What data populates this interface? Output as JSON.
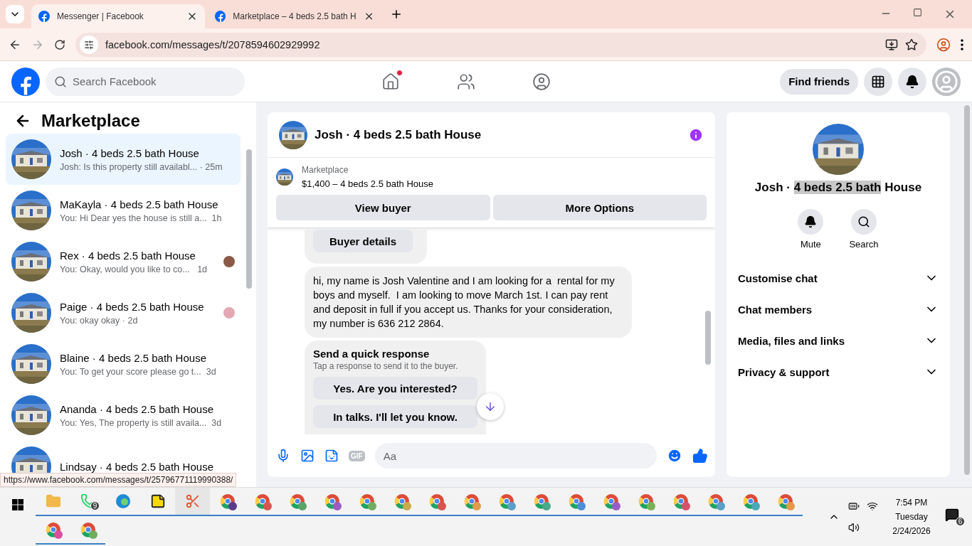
{
  "browser": {
    "tabs": [
      {
        "title": "Messenger | Facebook",
        "selected": true
      },
      {
        "title": "Marketplace – 4 beds 2.5 bath H",
        "selected": false
      }
    ],
    "url": "facebook.com/messages/t/2078594602929992"
  },
  "header": {
    "search_placeholder": "Search Facebook",
    "nav": [
      {
        "kind": "home",
        "badge": true
      },
      {
        "kind": "friends",
        "badge": false
      },
      {
        "kind": "groups",
        "badge": false
      }
    ],
    "find_friends": "Find friends"
  },
  "sidebar": {
    "title": "Marketplace",
    "conversations": [
      {
        "title": "Josh · 4 beds 2.5 bath House",
        "preview": "Josh: Is this property still availabl... · 25m",
        "selected": true
      },
      {
        "title": "MaKayla · 4 beds 2.5 bath House",
        "preview": "You: Hi Dear yes the house is still a...  1h",
        "selected": false
      },
      {
        "title": "Rex · 4 beds 2.5 bath House",
        "preview": "You: Okay, would you like to co...   1d",
        "selected": false,
        "color": "#8a5a48"
      },
      {
        "title": "Paige · 4 beds 2.5 bath House",
        "preview": "You: okay okay · 2d",
        "selected": false,
        "color": "#e3a8b4"
      },
      {
        "title": "Blaine · 4 beds 2.5 bath House",
        "preview": "You: To get your score please go t...  3d",
        "selected": false
      },
      {
        "title": "Ananda · 4 beds 2.5 bath House",
        "preview": "You: Yes, The property is still availa...  3d",
        "selected": false
      },
      {
        "title": "Lindsay · 4 beds 2.5 bath House",
        "selected": false
      }
    ]
  },
  "status_url": "https://www.facebook.com/messages/t/25796771119990388/",
  "chat": {
    "title": "Josh · 4 beds 2.5 bath House",
    "listing": {
      "label": "Marketplace",
      "title": "$1,400 – 4 beds 2.5 bath House"
    },
    "buttons": [
      "View buyer",
      "More Options"
    ],
    "messages": [
      {
        "kind": "action",
        "label": "Buyer details"
      },
      {
        "kind": "text",
        "text": "hi, my name is Josh Valentine and I am looking for a  rental for my boys and myself.  I am looking to move March 1st. I can pay rent and deposit in full if you accept us. Thanks for your consideration, my number is 636 212 2864."
      },
      {
        "kind": "quick",
        "title": "Send a quick response",
        "subtitle": "Tap a response to send it to the buyer.",
        "options": [
          "Yes. Are you interested?",
          "In talks. I'll let you know."
        ]
      }
    ],
    "composer": {
      "placeholder": "Aa",
      "gif": "GIF"
    }
  },
  "details": {
    "name_before": "Josh · ",
    "name_selected": "4 beds 2.5 bath",
    "name_after": " House",
    "actions": [
      {
        "kind": "mute",
        "label": "Mute"
      },
      {
        "kind": "search",
        "label": "Search"
      }
    ],
    "sections": [
      "Customise chat",
      "Chat members",
      "Media, files and links",
      "Privacy & support"
    ]
  },
  "taskbar": {
    "apps": [
      {
        "kind": "folder"
      },
      {
        "kind": "whatsapp",
        "count": "9"
      },
      {
        "kind": "edge"
      },
      {
        "kind": "notes"
      },
      {
        "kind": "snip"
      },
      {
        "kind": "chrome",
        "color": "#5b3c8c"
      },
      {
        "kind": "chrome",
        "color": "#d9534f"
      },
      {
        "kind": "chrome",
        "color": "#5aa469"
      },
      {
        "kind": "chrome",
        "color": "#9c5bc4"
      },
      {
        "kind": "chrome",
        "color": "#6fae5f"
      },
      {
        "kind": "chrome",
        "color": "#c9a94a"
      },
      {
        "kind": "chrome",
        "color": "#d9534f"
      },
      {
        "kind": "chrome",
        "color": "#e39a4a"
      },
      {
        "kind": "chrome",
        "color": "#5aa0c9"
      },
      {
        "kind": "chrome",
        "color": "#4aa88a"
      },
      {
        "kind": "chrome",
        "color": "#4d8fd6"
      },
      {
        "kind": "chrome",
        "color": "#9c5bc4"
      },
      {
        "kind": "chrome",
        "color": "#7bb05a"
      },
      {
        "kind": "chrome",
        "color": "#d94f6a"
      },
      {
        "kind": "chrome",
        "color": "#5aa0c9"
      },
      {
        "kind": "chrome",
        "color": "#4aa8b8"
      },
      {
        "kind": "chrome",
        "color": "#e39a4a"
      },
      {
        "kind": "chrome",
        "color": "#d94fa0"
      },
      {
        "kind": "chrome",
        "color": "#6fae5f"
      }
    ],
    "time": "7:54 PM",
    "day": "Tuesday",
    "date": "2/24/2026",
    "notifications": "6"
  }
}
